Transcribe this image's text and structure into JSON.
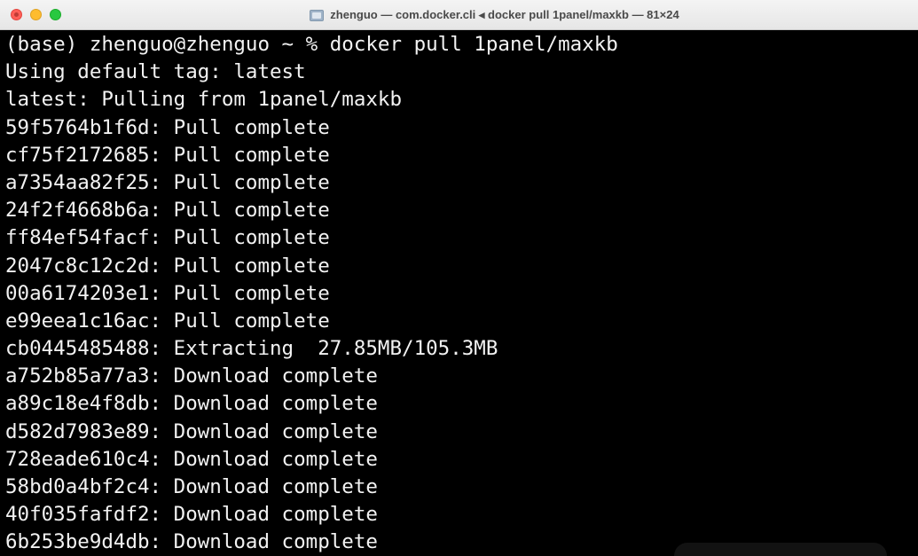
{
  "window": {
    "title": "zhenguo — com.docker.cli ◂ docker pull 1panel/maxkb — 81×24",
    "title_icon": "terminal-folder-icon",
    "controls": {
      "close": "close-button",
      "minimize": "minimize-button",
      "zoom": "zoom-button"
    },
    "colors": {
      "background": "#000000",
      "text": "#f2f2f2",
      "close": "#ff5f57",
      "minimize": "#febc2e",
      "zoom": "#28c840"
    }
  },
  "terminal": {
    "lines": [
      "(base) zhenguo@zhenguo ~ % docker pull 1panel/maxkb",
      "Using default tag: latest",
      "latest: Pulling from 1panel/maxkb",
      "59f5764b1f6d: Pull complete",
      "cf75f2172685: Pull complete",
      "a7354aa82f25: Pull complete",
      "24f2f4668b6a: Pull complete",
      "ff84ef54facf: Pull complete",
      "2047c8c12c2d: Pull complete",
      "00a6174203e1: Pull complete",
      "e99eea1c16ac: Pull complete",
      "cb0445485488: Extracting  27.85MB/105.3MB",
      "a752b85a77a3: Download complete",
      "a89c18e4f8db: Download complete",
      "d582d7983e89: Download complete",
      "728eade610c4: Download complete",
      "58bd0a4bf2c4: Download complete",
      "40f035fafdf2: Download complete",
      "6b253be9d4db: Download complete"
    ]
  }
}
